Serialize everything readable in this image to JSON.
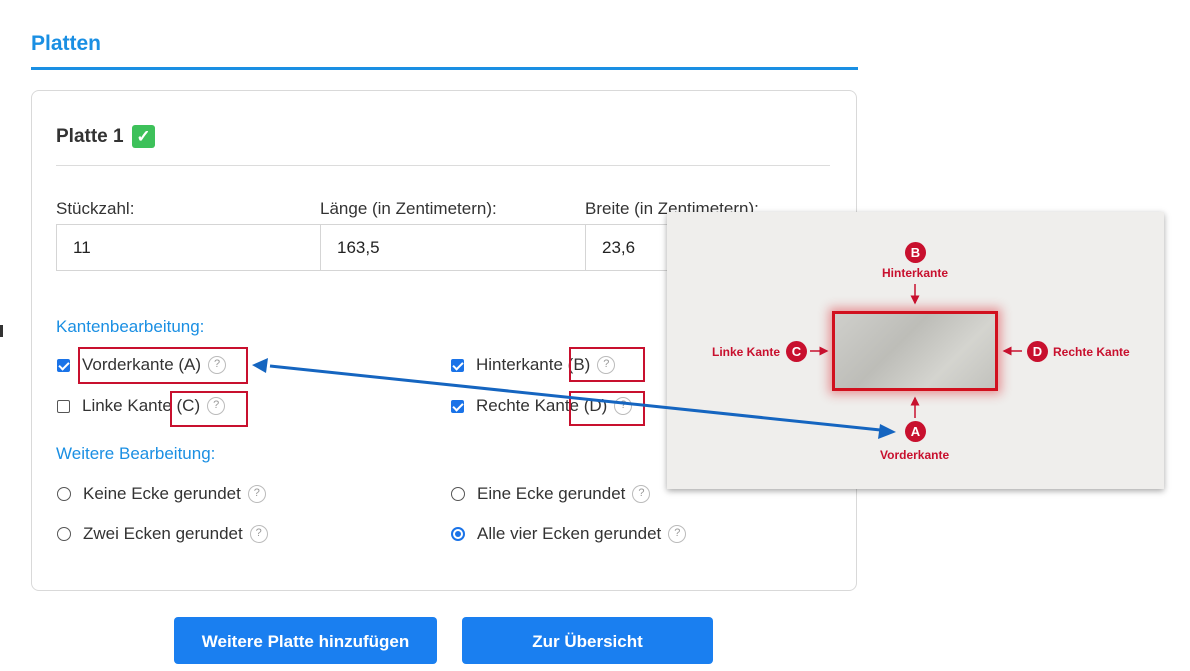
{
  "section": {
    "title": "Platten"
  },
  "plate": {
    "title": "Platte 1"
  },
  "fields": {
    "quantity": {
      "label": "Stückzahl:",
      "value": "11"
    },
    "length": {
      "label": "Länge (in Zentimetern):",
      "value": "163,5"
    },
    "width": {
      "label": "Breite (in Zentimetern):",
      "value": "23,6"
    }
  },
  "edges": {
    "title": "Kantenbearbeitung:",
    "front": {
      "label": "Vorderkante (A)",
      "checked": true
    },
    "back": {
      "label": "Hinterkante (B)",
      "checked": true
    },
    "left": {
      "label": "Linke Kante (C)",
      "checked": false
    },
    "right": {
      "label": "Rechte Kante (D)",
      "checked": true
    },
    "help": "?"
  },
  "corners": {
    "title": "Weitere Bearbeitung:",
    "none": {
      "label": "Keine Ecke gerundet",
      "selected": false
    },
    "one": {
      "label": "Eine Ecke gerundet",
      "selected": false
    },
    "two": {
      "label": "Zwei Ecken gerundet",
      "selected": false
    },
    "four": {
      "label": "Alle vier Ecken gerundet",
      "selected": true
    }
  },
  "buttons": {
    "add_plate": "Weitere Platte hinzufügen",
    "overview": "Zur Übersicht"
  },
  "diagram": {
    "a_letter": "A",
    "a_label": "Vorderkante",
    "b_letter": "B",
    "b_label": "Hinterkante",
    "c_letter": "C",
    "c_label": "Linke Kante",
    "d_letter": "D",
    "d_label": "Rechte Kante"
  },
  "colors": {
    "accent": "#1a8fe3",
    "button": "#1a7ff0",
    "annotation_red": "#c8102e",
    "checkmark_green": "#3dc15a"
  }
}
